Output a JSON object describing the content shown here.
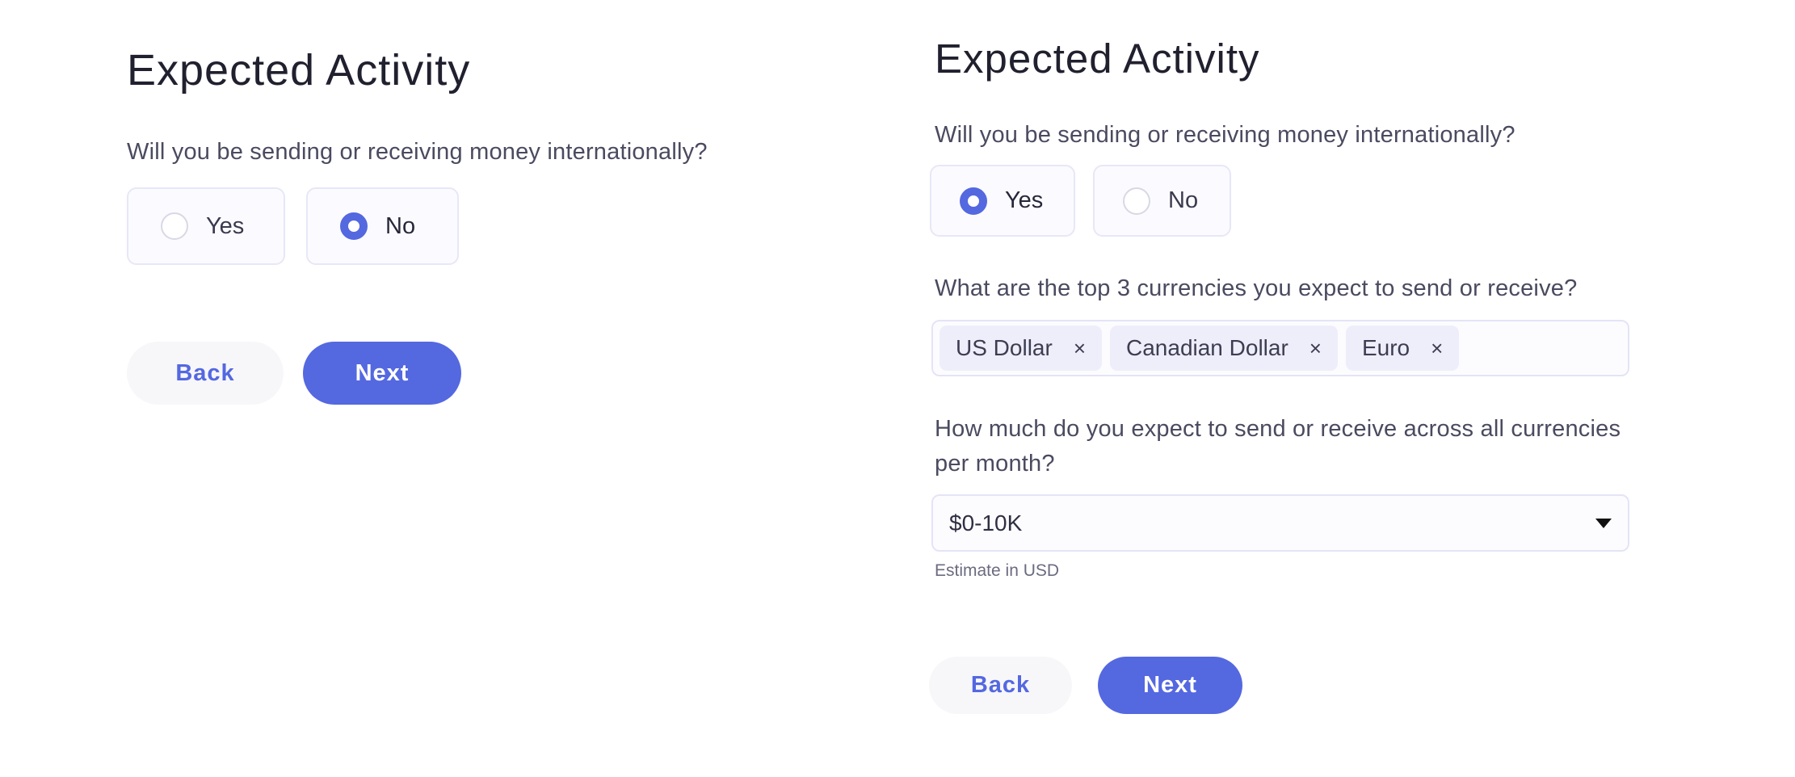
{
  "colors": {
    "accent": "#5468e0",
    "title_text": "#20202f",
    "body_text": "#4a4a60",
    "secondary_button_bg": "#f7f7fa",
    "chip_bg": "#eeeefb",
    "field_border": "#e4e4f7"
  },
  "left": {
    "title": "Expected Activity",
    "question_international": "Will you be sending or receiving money internationally?",
    "options": [
      {
        "label": "Yes",
        "selected": false
      },
      {
        "label": "No",
        "selected": true
      }
    ],
    "back_label": "Back",
    "next_label": "Next"
  },
  "right": {
    "title": "Expected Activity",
    "question_international": "Will you be sending or receiving money internationally?",
    "options": [
      {
        "label": "Yes",
        "selected": true
      },
      {
        "label": "No",
        "selected": false
      }
    ],
    "question_currencies": "What are the top 3 currencies you expect to send or receive?",
    "currencies": [
      {
        "label": "US Dollar",
        "remove_icon": "×"
      },
      {
        "label": "Canadian Dollar",
        "remove_icon": "×"
      },
      {
        "label": "Euro",
        "remove_icon": "×"
      }
    ],
    "question_volume": "How much do you expect to send or receive across all currencies per month?",
    "volume_select": {
      "value": "$0-10K",
      "icon": "caret-down-icon"
    },
    "volume_hint": "Estimate in USD",
    "back_label": "Back",
    "next_label": "Next"
  }
}
